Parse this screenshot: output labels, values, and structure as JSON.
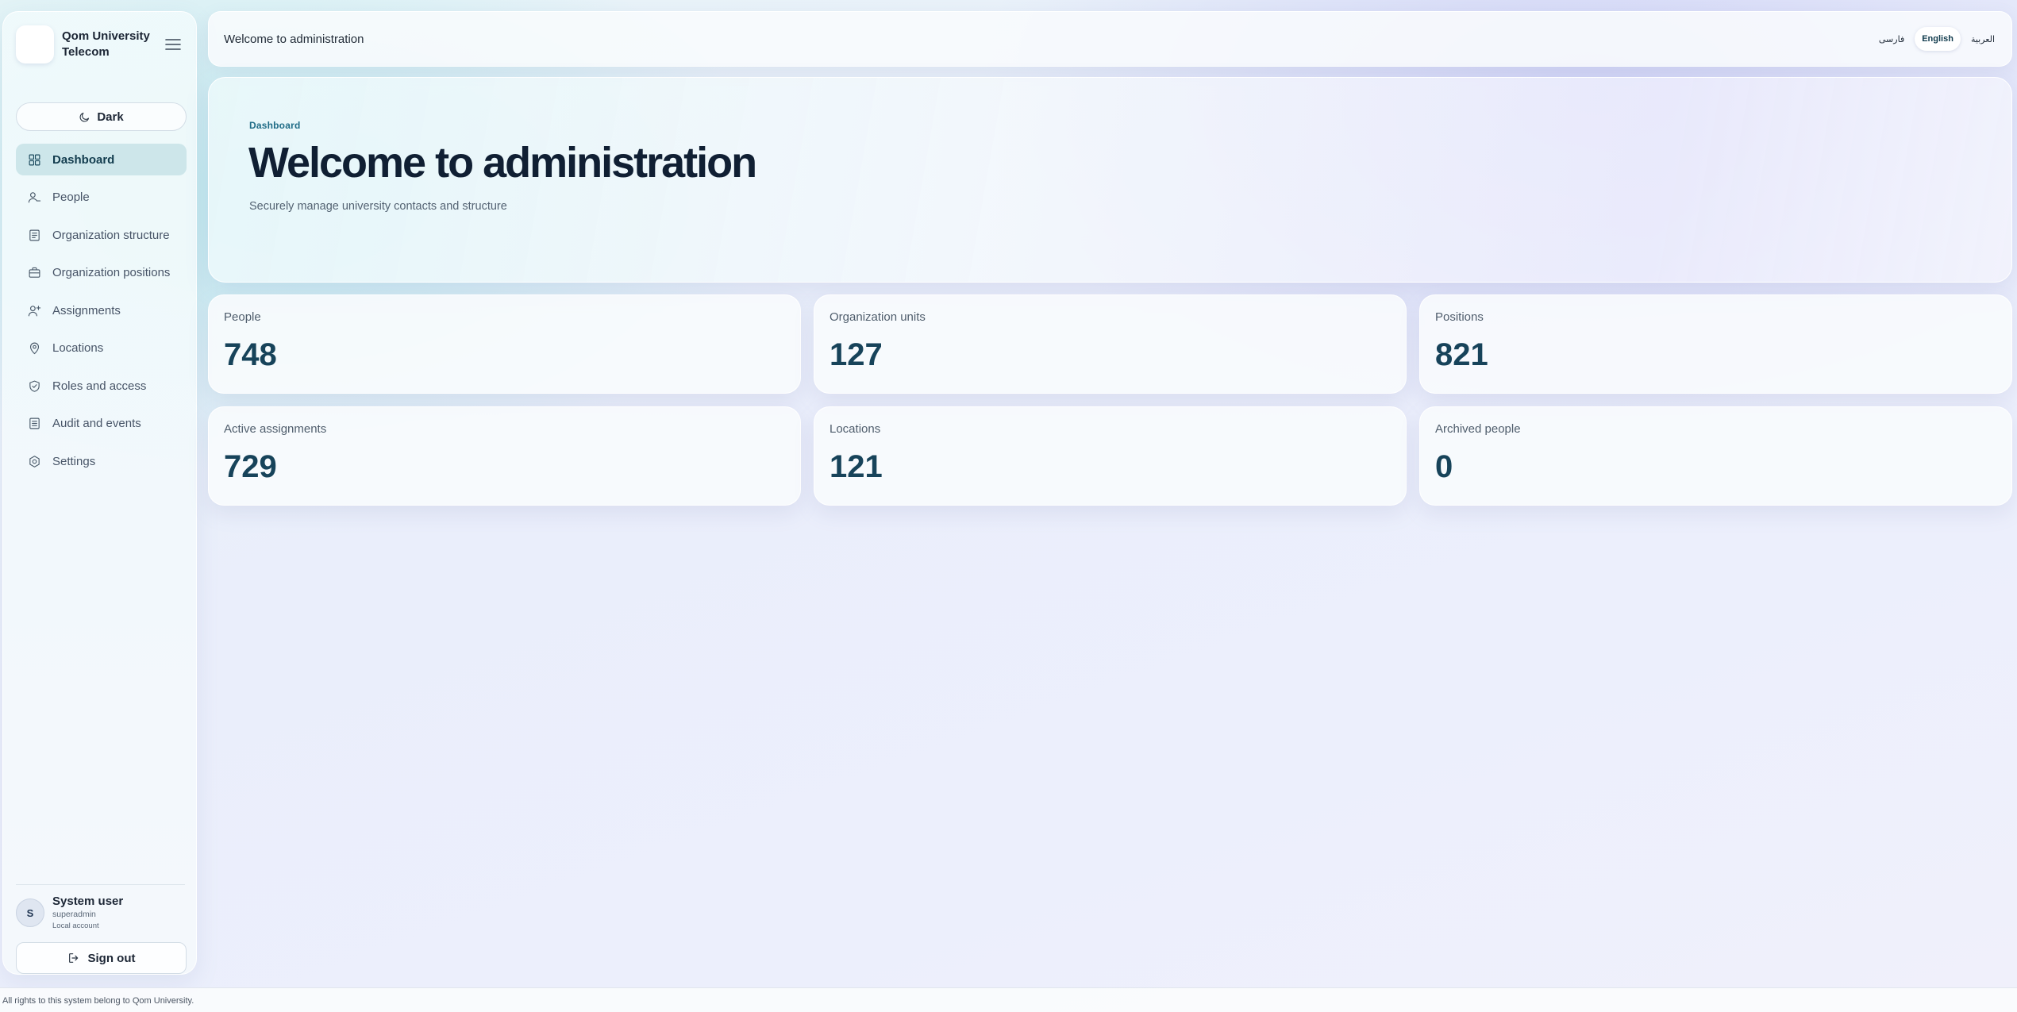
{
  "brand": {
    "name": "Qom University Telecom"
  },
  "sidebar": {
    "theme_toggle_label": "Dark",
    "items": [
      {
        "label": "Dashboard",
        "icon": "grid-icon",
        "active": true
      },
      {
        "label": "People",
        "icon": "person-icon"
      },
      {
        "label": "Organization structure",
        "icon": "document-icon"
      },
      {
        "label": "Organization positions",
        "icon": "briefcase-icon"
      },
      {
        "label": "Assignments",
        "icon": "user-plus-icon"
      },
      {
        "label": "Locations",
        "icon": "map-pin-icon"
      },
      {
        "label": "Roles and access",
        "icon": "shield-check-icon"
      },
      {
        "label": "Audit and events",
        "icon": "clipboard-icon"
      },
      {
        "label": "Settings",
        "icon": "gear-icon"
      }
    ],
    "user": {
      "initial": "S",
      "name": "System user",
      "login": "superadmin",
      "account_type": "Local account"
    },
    "signout_label": "Sign out"
  },
  "topbar": {
    "title": "Welcome to administration",
    "languages": [
      {
        "label": "فارسی",
        "active": false
      },
      {
        "label": "English",
        "active": true
      },
      {
        "label": "العربية",
        "active": false
      }
    ]
  },
  "hero": {
    "kicker": "Dashboard",
    "title": "Welcome to administration",
    "subtitle": "Securely manage university contacts and structure"
  },
  "stats": [
    {
      "label": "People",
      "value": "748"
    },
    {
      "label": "Organization units",
      "value": "127"
    },
    {
      "label": "Positions",
      "value": "821"
    },
    {
      "label": "Active assignments",
      "value": "729"
    },
    {
      "label": "Locations",
      "value": "121"
    },
    {
      "label": "Archived people",
      "value": "0"
    }
  ],
  "footer": {
    "text": "All rights to this system belong to Qom University."
  },
  "colors": {
    "accent": "#17435a",
    "active_nav_bg": "#cde6ea",
    "kicker": "#1e6b86"
  }
}
